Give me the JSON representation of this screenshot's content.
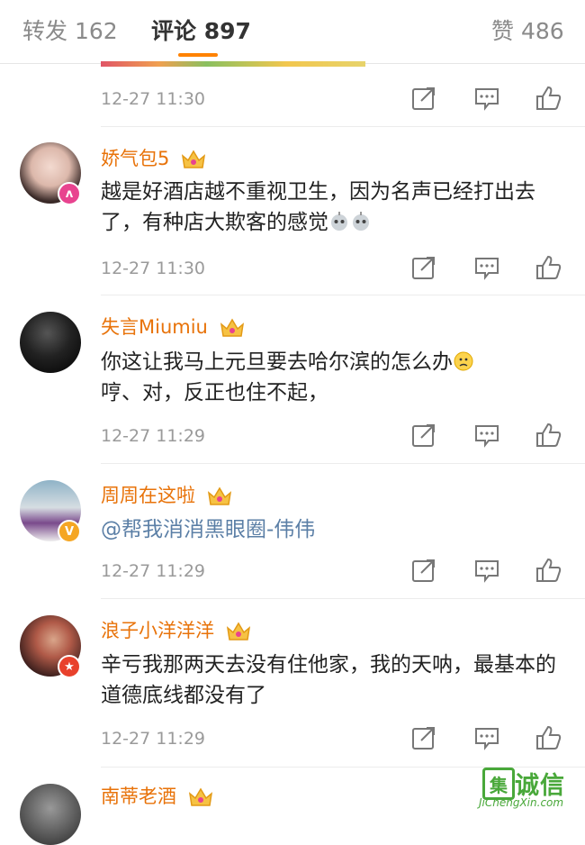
{
  "tabs": [
    {
      "label": "转发",
      "count": "162"
    },
    {
      "label": "评论",
      "count": "897"
    },
    {
      "label": "赞",
      "count": "486"
    }
  ],
  "comments": [
    {
      "username": "",
      "text": "",
      "time": "12-27 11:30"
    },
    {
      "username": "娇气包5",
      "text": "越是好酒店越不重视卫生，因为名声已经打出去了，有种店大欺客的感觉",
      "time": "12-27 11:30",
      "avatar_badge": "weibo-girl"
    },
    {
      "username": "失言Miumiu",
      "text": "你这让我马上元旦要去哈尔滨的怎么办",
      "text2": "哼、对，反正也住不起，",
      "time": "12-27 11:29"
    },
    {
      "username": "周周在这啦",
      "text": "@帮我消消黑眼圈-伟伟",
      "time": "12-27 11:29",
      "avatar_badge": "V"
    },
    {
      "username": "浪子小洋洋洋",
      "text": "辛亏我那两天去没有住他家，我的天呐，最基本的道德底线都没有了",
      "time": "12-27 11:29",
      "avatar_badge": "star"
    },
    {
      "username": "南蒂老酒",
      "text": "",
      "time": ""
    }
  ],
  "actions": {
    "forward_icon": "forward-icon",
    "comment_icon": "comment-icon",
    "like_icon": "thumbs-up-icon"
  },
  "watermark": {
    "cn": "诚信",
    "box": "集",
    "en": "JiChengXin.com"
  },
  "colors": {
    "accent": "#ff8200",
    "username": "#e8730a",
    "mention": "#5b7fa6",
    "time": "#9a9a9a"
  }
}
